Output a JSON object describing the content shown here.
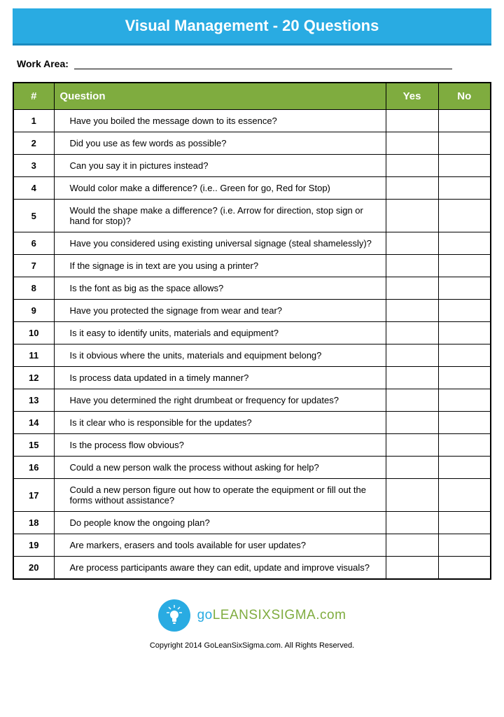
{
  "title": "Visual Management - 20 Questions",
  "work_area_label": "Work Area:",
  "table": {
    "headers": {
      "num": "#",
      "question": "Question",
      "yes": "Yes",
      "no": "No"
    },
    "rows": [
      {
        "n": "1",
        "q": "Have you boiled the message down to its essence?"
      },
      {
        "n": "2",
        "q": "Did you use as few words as possible?"
      },
      {
        "n": "3",
        "q": "Can you say it in pictures instead?"
      },
      {
        "n": "4",
        "q": "Would color make a difference? (i.e.. Green for go, Red for Stop)"
      },
      {
        "n": "5",
        "q": "Would the shape make a difference? (i.e. Arrow for direction, stop sign or hand for stop)?"
      },
      {
        "n": "6",
        "q": "Have you considered using existing universal signage (steal shamelessly)?"
      },
      {
        "n": "7",
        "q": "If the signage is in text are you using a printer?"
      },
      {
        "n": "8",
        "q": "Is the font as big as the space allows?"
      },
      {
        "n": "9",
        "q": "Have you protected the signage from wear and tear?"
      },
      {
        "n": "10",
        "q": "Is it easy to identify units, materials and equipment?"
      },
      {
        "n": "11",
        "q": "Is it obvious where the units, materials and equipment belong?"
      },
      {
        "n": "12",
        "q": "Is process data updated in a timely manner?"
      },
      {
        "n": "13",
        "q": "Have you determined the right drumbeat or frequency for updates?"
      },
      {
        "n": "14",
        "q": "Is it clear who is responsible for the updates?"
      },
      {
        "n": "15",
        "q": "Is the process flow obvious?"
      },
      {
        "n": "16",
        "q": "Could a new person walk the process without asking for help?"
      },
      {
        "n": "17",
        "q": "Could a new person figure out how to operate the equipment or fill out the forms without assistance?"
      },
      {
        "n": "18",
        "q": "Do people know the ongoing plan?"
      },
      {
        "n": "19",
        "q": "Are markers, erasers and tools available for user updates?"
      },
      {
        "n": "20",
        "q": "Are process participants aware they can edit, update and improve visuals?"
      }
    ]
  },
  "logo": {
    "go": "go",
    "lean": "LEAN",
    "six": "SIX",
    "sigma": "SIGMA",
    "dotcom": ".com"
  },
  "copyright": "Copyright 2014 GoLeanSixSigma.com. All Rights Reserved."
}
